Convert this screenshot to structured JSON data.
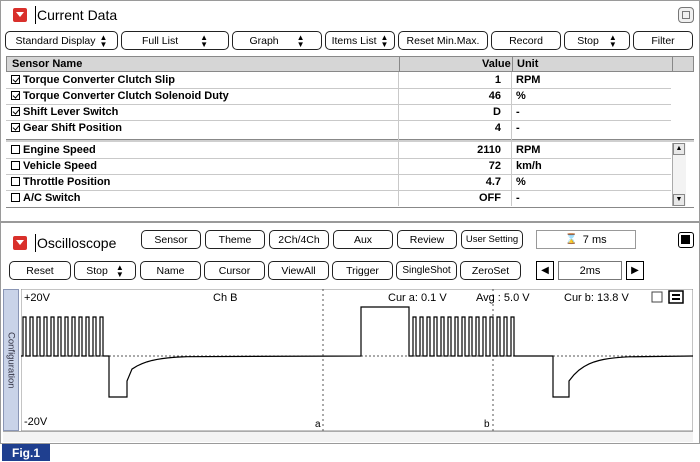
{
  "current_data": {
    "title": "Current Data",
    "toolbar": {
      "standard_display": "Standard Display",
      "full_list": "Full List",
      "graph": "Graph",
      "items_list": "Items List",
      "reset_min_max": "Reset Min.Max.",
      "record": "Record",
      "stop": "Stop",
      "filter": "Filter"
    },
    "columns": {
      "name": "Sensor Name",
      "value": "Value",
      "unit": "Unit"
    },
    "fixed_rows": [
      {
        "name": "Torque Converter Clutch Slip",
        "value": "1",
        "unit": "RPM",
        "checked": true
      },
      {
        "name": "Torque Converter Clutch Solenoid Duty",
        "value": "46",
        "unit": "%",
        "checked": true
      },
      {
        "name": "Shift Lever Switch",
        "value": "D",
        "unit": "-",
        "checked": true
      },
      {
        "name": "Gear Shift Position",
        "value": "4",
        "unit": "-",
        "checked": true
      }
    ],
    "scroll_rows": [
      {
        "name": "Engine Speed",
        "value": "2110",
        "unit": "RPM",
        "checked": false
      },
      {
        "name": "Vehicle Speed",
        "value": "72",
        "unit": "km/h",
        "checked": false
      },
      {
        "name": "Throttle Position",
        "value": "4.7",
        "unit": "%",
        "checked": false
      },
      {
        "name": "A/C Switch",
        "value": "OFF",
        "unit": "-",
        "checked": false
      }
    ]
  },
  "oscilloscope": {
    "title": "Oscilloscope",
    "tabs": {
      "sensor": "Sensor",
      "theme": "Theme",
      "channels": "2Ch/4Ch",
      "aux": "Aux",
      "review": "Review",
      "user_setting": "User Setting"
    },
    "time_display": "7 ms",
    "toolbar": {
      "reset": "Reset",
      "stop": "Stop",
      "name": "Name",
      "cursor": "Cursor",
      "view_all": "ViewAll",
      "trigger": "Trigger",
      "single_shot": "SingleShot",
      "zero_set": "ZeroSet",
      "time_div": "2ms"
    },
    "side_tab": "Configuration",
    "y_max_label": "+20V",
    "y_min_label": "-20V",
    "channel_label": "Ch B",
    "cursor_a": "Cur a: 0.1 V",
    "avg": "Avg : 5.0 V",
    "cursor_b": "Cur b: 13.8 V",
    "marker_a": "a",
    "marker_b": "b"
  },
  "figure_label": "Fig.1"
}
